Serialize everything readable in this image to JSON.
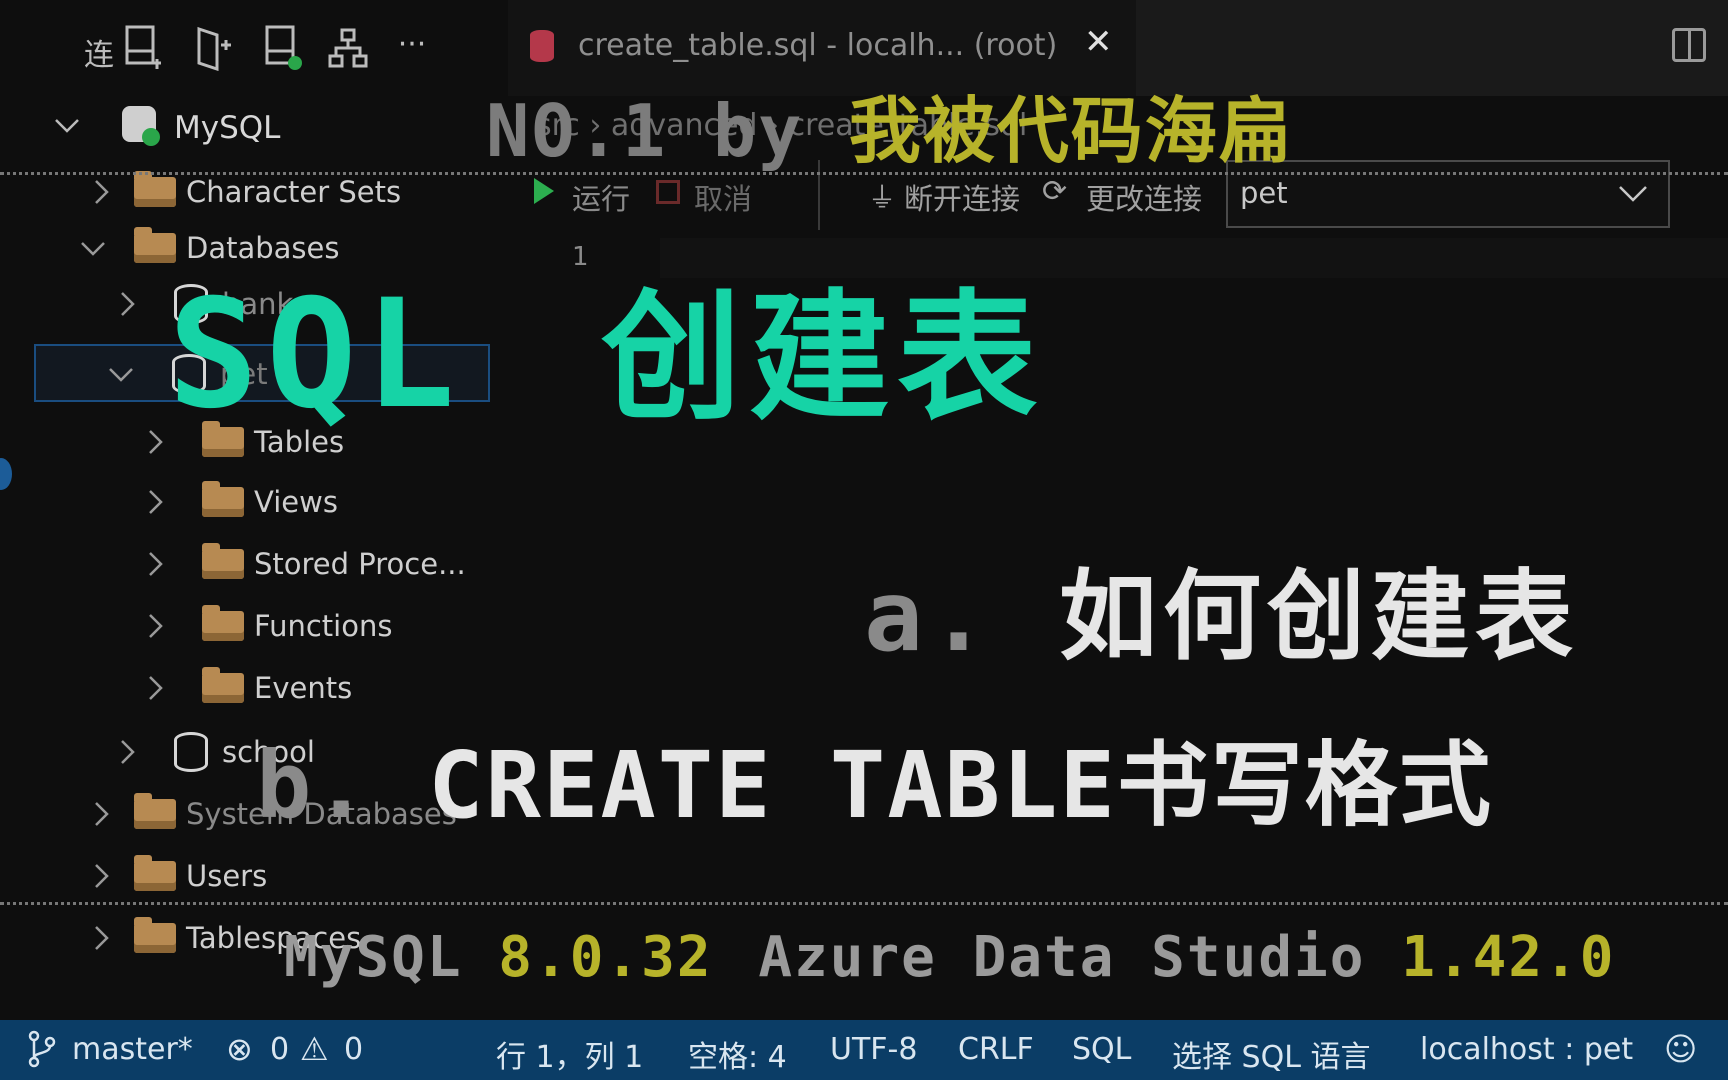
{
  "explorer": {
    "toolbar_partial_label": "连",
    "connection": "MySQL",
    "tree": [
      {
        "label": "Character Sets"
      },
      {
        "label": "Databases"
      },
      {
        "label": "bank"
      },
      {
        "label": "pet"
      },
      {
        "label": "Tables"
      },
      {
        "label": "Views"
      },
      {
        "label": "Stored Proce..."
      },
      {
        "label": "Functions"
      },
      {
        "label": "Events"
      },
      {
        "label": "school"
      },
      {
        "label": "System Databases"
      },
      {
        "label": "Users"
      },
      {
        "label": "Tablespaces"
      }
    ]
  },
  "tab": {
    "title": "create_table.sql - localh... (root)"
  },
  "breadcrumb": {
    "part1": "src",
    "part2": "advanced",
    "part3": "create_table.sql"
  },
  "query_toolbar": {
    "run": "运行",
    "cancel": "取消",
    "disconnect": "断开连接",
    "change_connection": "更改连接",
    "database_selected": "pet"
  },
  "editor": {
    "line_number": "1"
  },
  "overlay": {
    "header_prefix": "NO.1 by",
    "header_author": "我被代码海扁",
    "title_en": "SQL",
    "title_cn": "创建表",
    "item_a_prefix": "a.",
    "item_a_text": "如何创建表",
    "item_b_prefix": "b.",
    "item_b_text": "CREATE TABLE书写格式",
    "footer_mysql": "MySQL",
    "footer_mysql_version": "8.0.32",
    "footer_ads": "Azure Data Studio",
    "footer_ads_version": "1.42.0"
  },
  "statusbar": {
    "branch": "master*",
    "errors": "0",
    "warnings": "0",
    "position": "行 1，列 1",
    "spaces": "空格: 4",
    "encoding": "UTF-8",
    "eol": "CRLF",
    "language": "SQL",
    "select_language": "选择 SQL 语言",
    "connection": "localhost : pet"
  },
  "colors": {
    "accent_cyan": "#16d3a6",
    "accent_olive": "#b7b32a",
    "statusbar": "#0b3d66"
  }
}
